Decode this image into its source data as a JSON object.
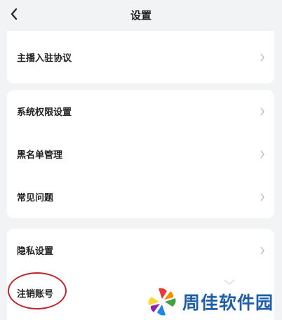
{
  "header": {
    "title": "设置"
  },
  "sections": [
    {
      "items": [
        {
          "label": "主播入驻协议"
        }
      ]
    },
    {
      "items": [
        {
          "label": "系统权限设置"
        },
        {
          "label": "黑名单管理"
        },
        {
          "label": "常见问题"
        }
      ]
    },
    {
      "items": [
        {
          "label": "隐私设置"
        },
        {
          "label": "注销账号"
        }
      ]
    }
  ],
  "icons": {
    "back": "chevron-left-icon",
    "row_arrow": "chevron-right-icon"
  },
  "colors": {
    "background": "#f2f3f5",
    "card": "#ffffff",
    "highlight": "#c0262d",
    "watermark_text": "#1f5fa8"
  },
  "watermark": {
    "text": "周佳软件园"
  }
}
